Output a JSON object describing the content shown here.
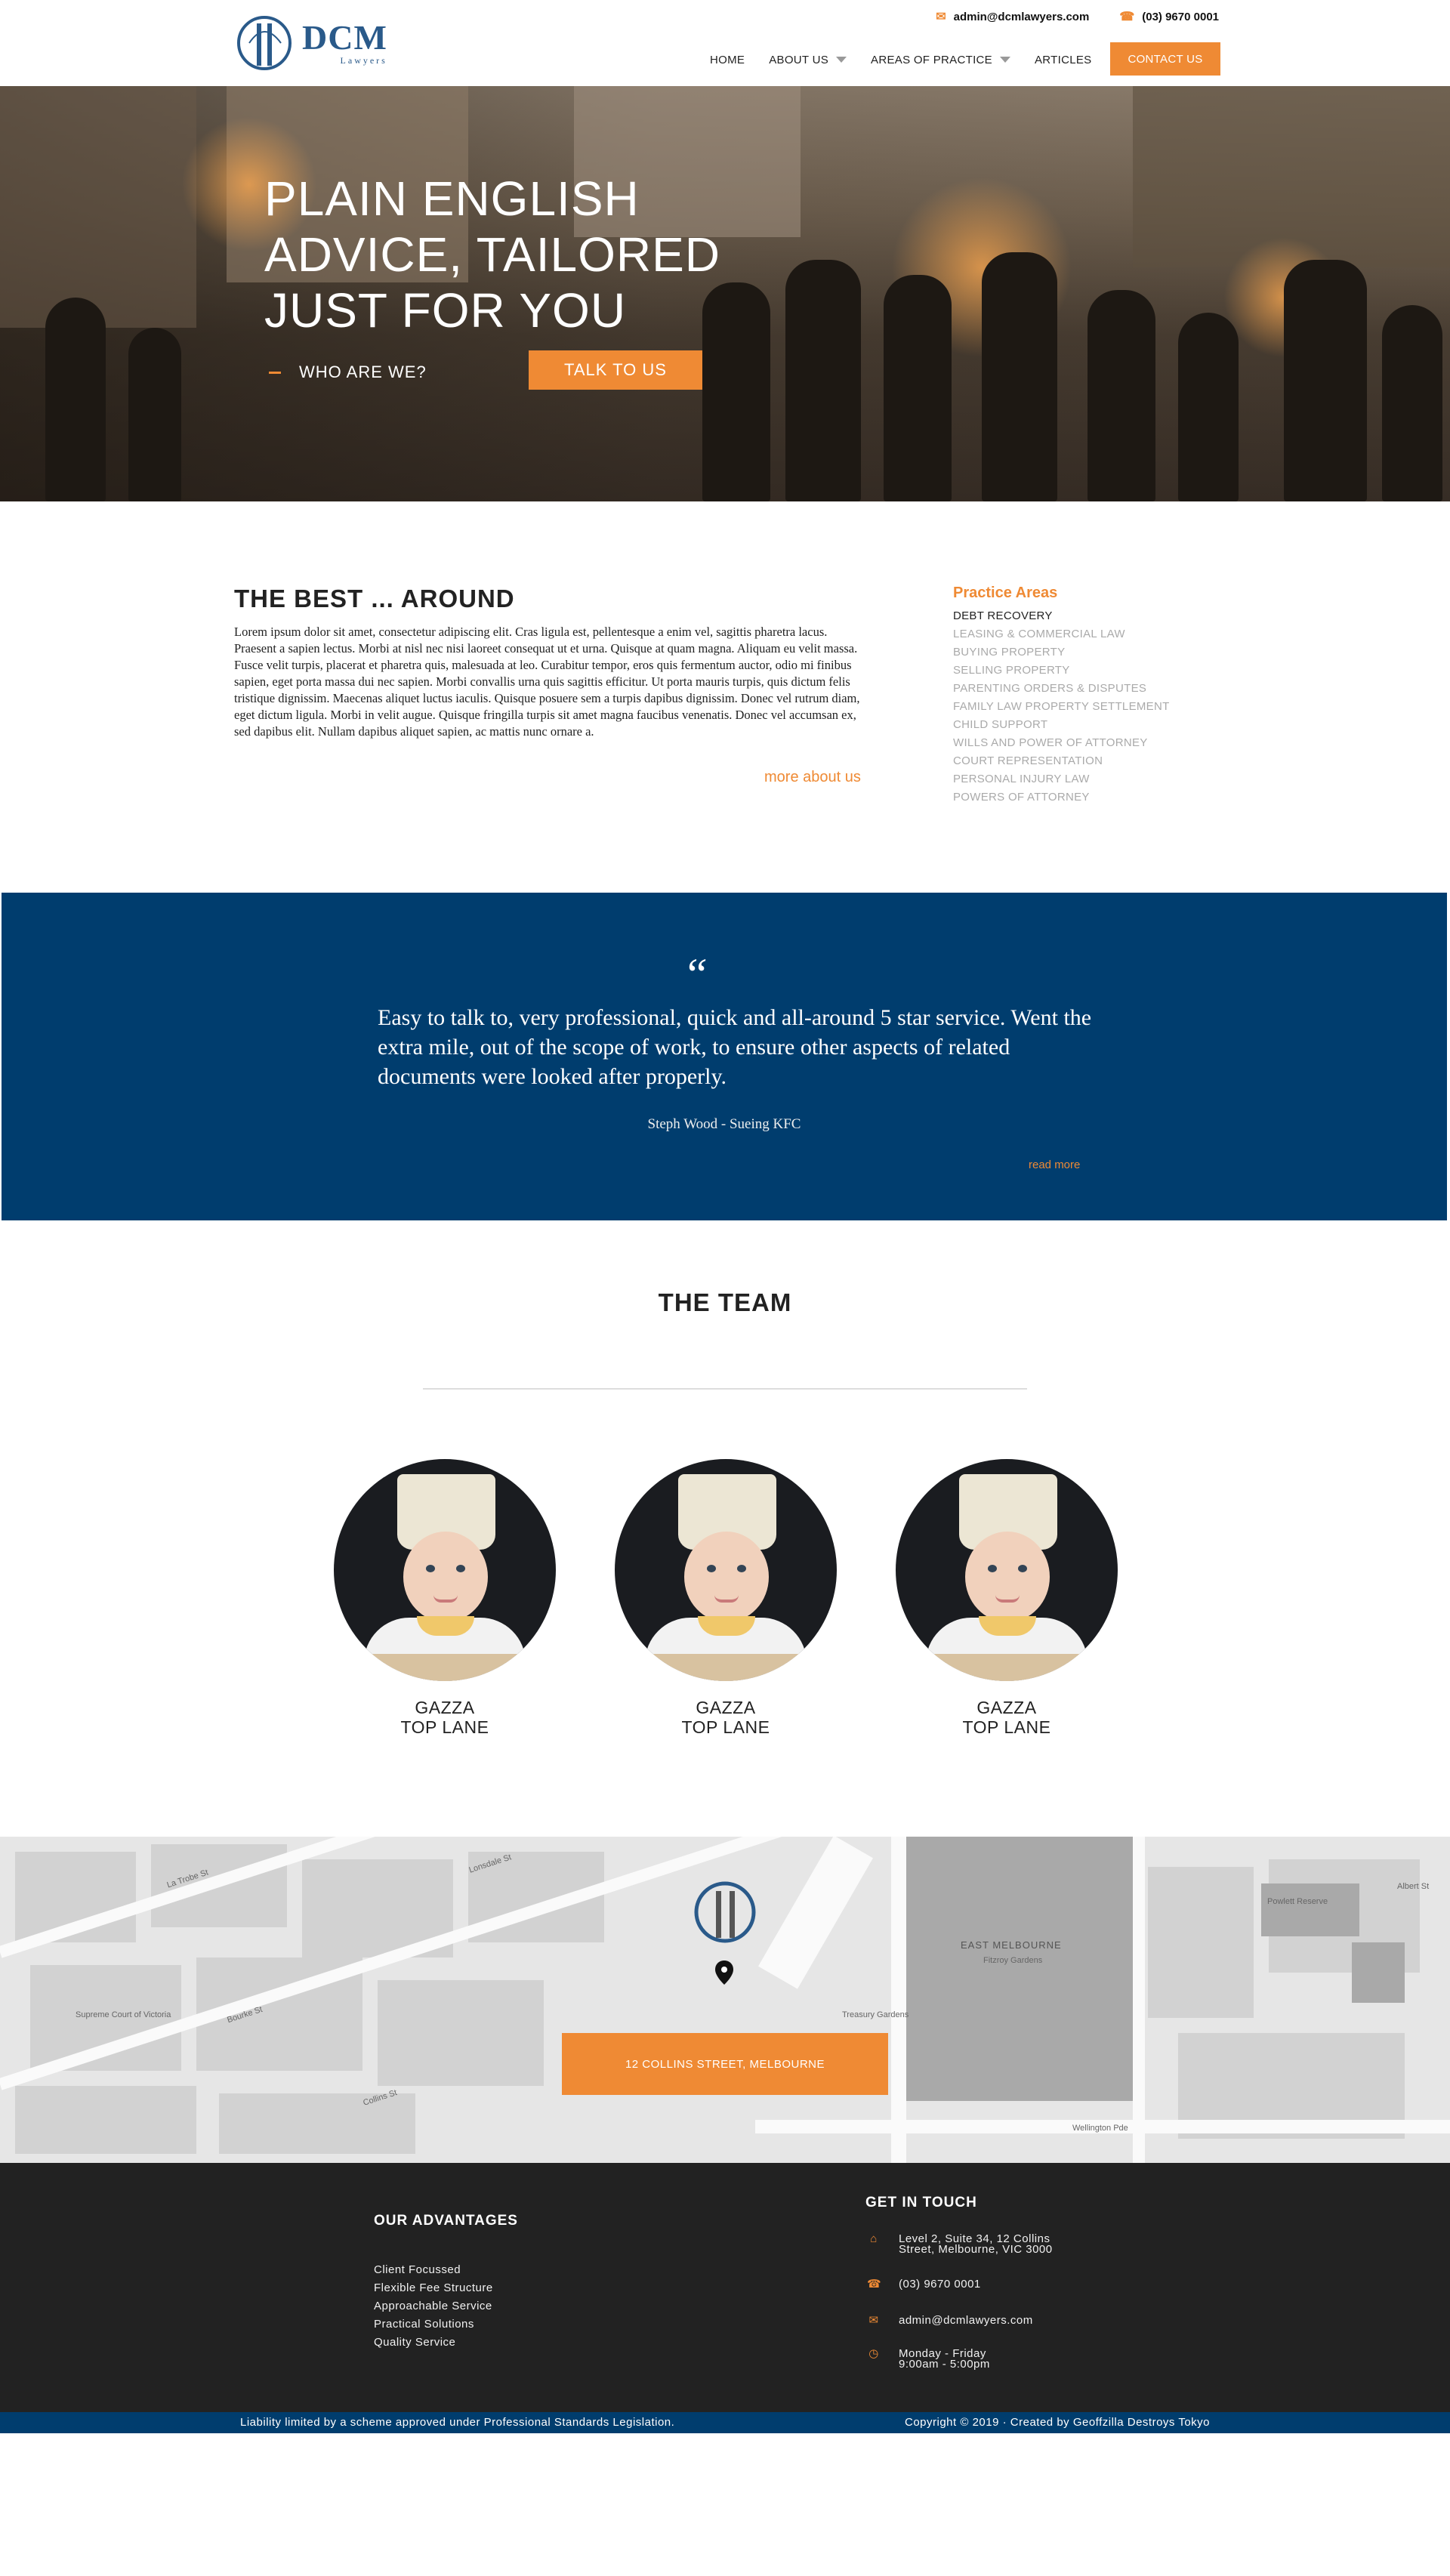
{
  "brand": {
    "name": "DCM",
    "tagline": "Lawyers"
  },
  "topbar": {
    "email": "admin@dcmlawyers.com",
    "phone": "(03) 9670 0001"
  },
  "nav": {
    "items": [
      {
        "label": "HOME",
        "has_dropdown": false
      },
      {
        "label": "ABOUT US",
        "has_dropdown": true
      },
      {
        "label": "AREAS OF PRACTICE",
        "has_dropdown": true
      },
      {
        "label": "ARTICLES",
        "has_dropdown": false
      }
    ],
    "contact_label": "CONTACT US"
  },
  "hero": {
    "title": "PLAIN ENGLISH ADVICE, TAILORED JUST FOR YOU",
    "secondary_label": "WHO ARE WE?",
    "cta_label": "TALK TO US"
  },
  "about": {
    "title": "THE BEST ... AROUND",
    "body": "Lorem ipsum dolor sit amet, consectetur adipiscing elit. Cras ligula est, pellentesque a enim vel, sagittis pharetra lacus. Praesent a sapien lectus. Morbi at nisl nec nisi laoreet consequat ut et urna. Quisque at quam magna. Aliquam eu velit massa. Fusce velit turpis, placerat et pharetra quis, malesuada at leo. Curabitur tempor, eros quis fermentum auctor, odio mi finibus sapien, eget porta massa dui nec sapien. Morbi convallis urna quis sagittis efficitur. Ut porta mauris turpis, quis dictum felis tristique dignissim. Maecenas aliquet luctus iaculis. Quisque posuere sem a turpis dapibus dignissim. Donec vel rutrum diam, eget dictum ligula. Morbi in velit augue. Quisque fringilla turpis sit amet magna faucibus venenatis. Donec vel accumsan ex, sed dapibus elit. Nullam dapibus aliquet sapien, ac mattis nunc ornare a.",
    "more_label": "more about us"
  },
  "practice_areas": {
    "title": "Practice Areas",
    "items": [
      "DEBT RECOVERY",
      "LEASING & COMMERCIAL LAW",
      "BUYING PROPERTY",
      "SELLING PROPERTY",
      "PARENTING ORDERS & DISPUTES",
      "FAMILY LAW PROPERTY SETTLEMENT",
      "CHILD SUPPORT",
      "WILLS AND POWER OF ATTORNEY",
      "COURT REPRESENTATION",
      "PERSONAL INJURY LAW",
      "POWERS OF ATTORNEY"
    ],
    "active_index": 0
  },
  "testimonial": {
    "quote_mark": "“",
    "text": "Easy to talk to, very professional, quick and all-around 5 star service. Went the extra mile, out of the scope of work, to ensure other aspects of related documents were looked after properly.",
    "author": "Steph Wood - Sueing KFC",
    "read_more": "read more"
  },
  "team": {
    "title": "THE TEAM",
    "members": [
      {
        "name": "GAZZA",
        "role": "TOP LANE"
      },
      {
        "name": "GAZZA",
        "role": "TOP LANE"
      },
      {
        "name": "GAZZA",
        "role": "TOP LANE"
      }
    ]
  },
  "map": {
    "address_label": "12 COLLINS STREET, MELBOURNE",
    "labels": {
      "east_melbourne": "EAST MELBOURNE",
      "fitzroy_gardens": "Fitzroy Gardens",
      "treasury_gardens": "Treasury Gardens",
      "la_trobe": "La Trobe St",
      "lonsdale": "Lonsdale St",
      "bourke": "Bourke St",
      "collins": "Collins St",
      "wellington_pde": "Wellington Pde",
      "albert": "Albert St",
      "powlett": "Powlett Reserve",
      "supreme_court": "Supreme Court of Victoria"
    }
  },
  "footer": {
    "advantages_title": "OUR ADVANTAGES",
    "advantages": [
      "Client Focussed",
      "Flexible Fee Structure",
      "Approachable Service",
      "Practical Solutions",
      "Quality Service"
    ],
    "contact_title": "GET IN TOUCH",
    "address_line1": "Level 2, Suite 34, 12 Collins",
    "address_line2": "Street, Melbourne, VIC 3000",
    "phone": "(03) 9670 0001",
    "email": "admin@dcmlawyers.com",
    "hours_line1": "Monday - Friday",
    "hours_line2": "9:00am - 5:00pm",
    "liability": "Liability limited by a scheme approved under Professional Standards Legislation.",
    "copyright": "Copyright © 2019 · Created by Geoffzilla Destroys Tokyo"
  },
  "colors": {
    "accent": "#ef8a34",
    "navy": "#003d6e",
    "footer_bg": "#222222"
  }
}
